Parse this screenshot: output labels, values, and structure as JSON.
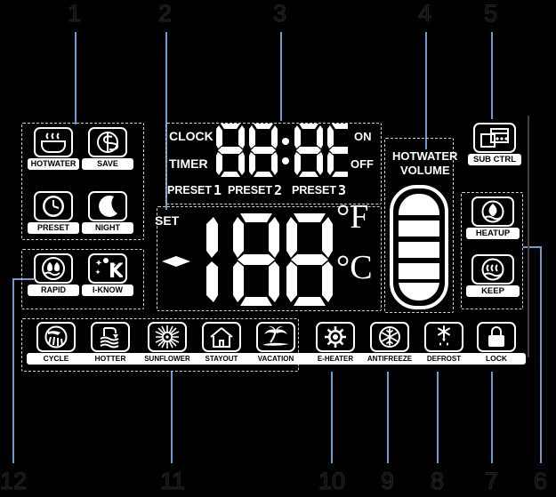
{
  "device": {
    "title": "Water Heater LCD Control Panel Display",
    "background_color": "#000000",
    "lcd_color": "#ffffff",
    "callout_line_color": "#6d9ccd"
  },
  "callouts": [
    {
      "id": "1",
      "label": "1"
    },
    {
      "id": "2",
      "label": "2"
    },
    {
      "id": "3",
      "label": "3"
    },
    {
      "id": "4",
      "label": "4"
    },
    {
      "id": "5",
      "label": "5"
    },
    {
      "id": "6",
      "label": "6"
    },
    {
      "id": "7",
      "label": "7"
    },
    {
      "id": "8",
      "label": "8"
    },
    {
      "id": "9",
      "label": "9"
    },
    {
      "id": "10",
      "label": "10"
    },
    {
      "id": "11",
      "label": "11"
    },
    {
      "id": "12",
      "label": "12"
    }
  ],
  "left_panel": {
    "group_top": {
      "icons": [
        {
          "name": "hotwater",
          "label": "HOTWATER",
          "icon": "hotwater-basin-icon"
        },
        {
          "name": "save",
          "label": "SAVE",
          "icon": "dollar-save-icon"
        },
        {
          "name": "preset",
          "label": "PRESET",
          "icon": "clock-icon"
        },
        {
          "name": "night",
          "label": "NIGHT",
          "icon": "crescent-moon-icon"
        }
      ]
    },
    "group_bottom": {
      "icons": [
        {
          "name": "rapid",
          "label": "RAPID",
          "icon": "rapid-flames-icon"
        },
        {
          "name": "i-know",
          "label": "I-KNOW",
          "icon": "i-know-sparkle-icon"
        }
      ]
    }
  },
  "center_display": {
    "clock_row": {
      "clock_label": "CLOCK",
      "timer_label": "TIMER",
      "on_label": "ON",
      "off_label": "OFF",
      "digits": "88:88"
    },
    "preset_row": [
      {
        "label": "PRESET",
        "number": "1"
      },
      {
        "label": "PRESET",
        "number": "2"
      },
      {
        "label": "PRESET",
        "number": "3"
      }
    ],
    "main_temp": {
      "set_label": "SET",
      "sign": "-",
      "digits": "188",
      "unit_f": "°F",
      "unit_c": "°C"
    }
  },
  "hotwater_volume": {
    "label_line1": "HOTWATER",
    "label_line2": "VOLUME",
    "segments_total": 5,
    "segments_filled": 5
  },
  "right_panel": {
    "sub_ctrl": {
      "label": "SUB CTRL",
      "icon": "sub-control-panel-icon"
    },
    "group": {
      "icons": [
        {
          "name": "heatup",
          "label": "HEATUP",
          "icon": "flame-drop-icon"
        },
        {
          "name": "keep",
          "label": "KEEP",
          "icon": "keep-warm-waves-icon"
        }
      ]
    }
  },
  "bottom_row": {
    "group_left": {
      "icons": [
        {
          "name": "cycle",
          "label": "CYCLE",
          "icon": "shower-cycle-icon"
        },
        {
          "name": "hotter",
          "label": "HOTTER",
          "icon": "faucet-hot-icon"
        },
        {
          "name": "sunflower",
          "label": "SUNFLOWER",
          "icon": "sunflower-icon"
        },
        {
          "name": "stayout",
          "label": "STAYOUT",
          "icon": "house-icon"
        },
        {
          "name": "vacation",
          "label": "VACATION",
          "icon": "palm-tree-icon"
        }
      ]
    },
    "standalone": {
      "icons": [
        {
          "name": "e-heater",
          "label": "E-HEATER",
          "icon": "electric-heater-gear-icon"
        },
        {
          "name": "antifreeze",
          "label": "ANTIFREEZE",
          "icon": "snowflake-icon"
        },
        {
          "name": "defrost",
          "label": "DEFROST",
          "icon": "defrost-drip-icon"
        },
        {
          "name": "lock",
          "label": "LOCK",
          "icon": "padlock-icon"
        }
      ]
    }
  }
}
